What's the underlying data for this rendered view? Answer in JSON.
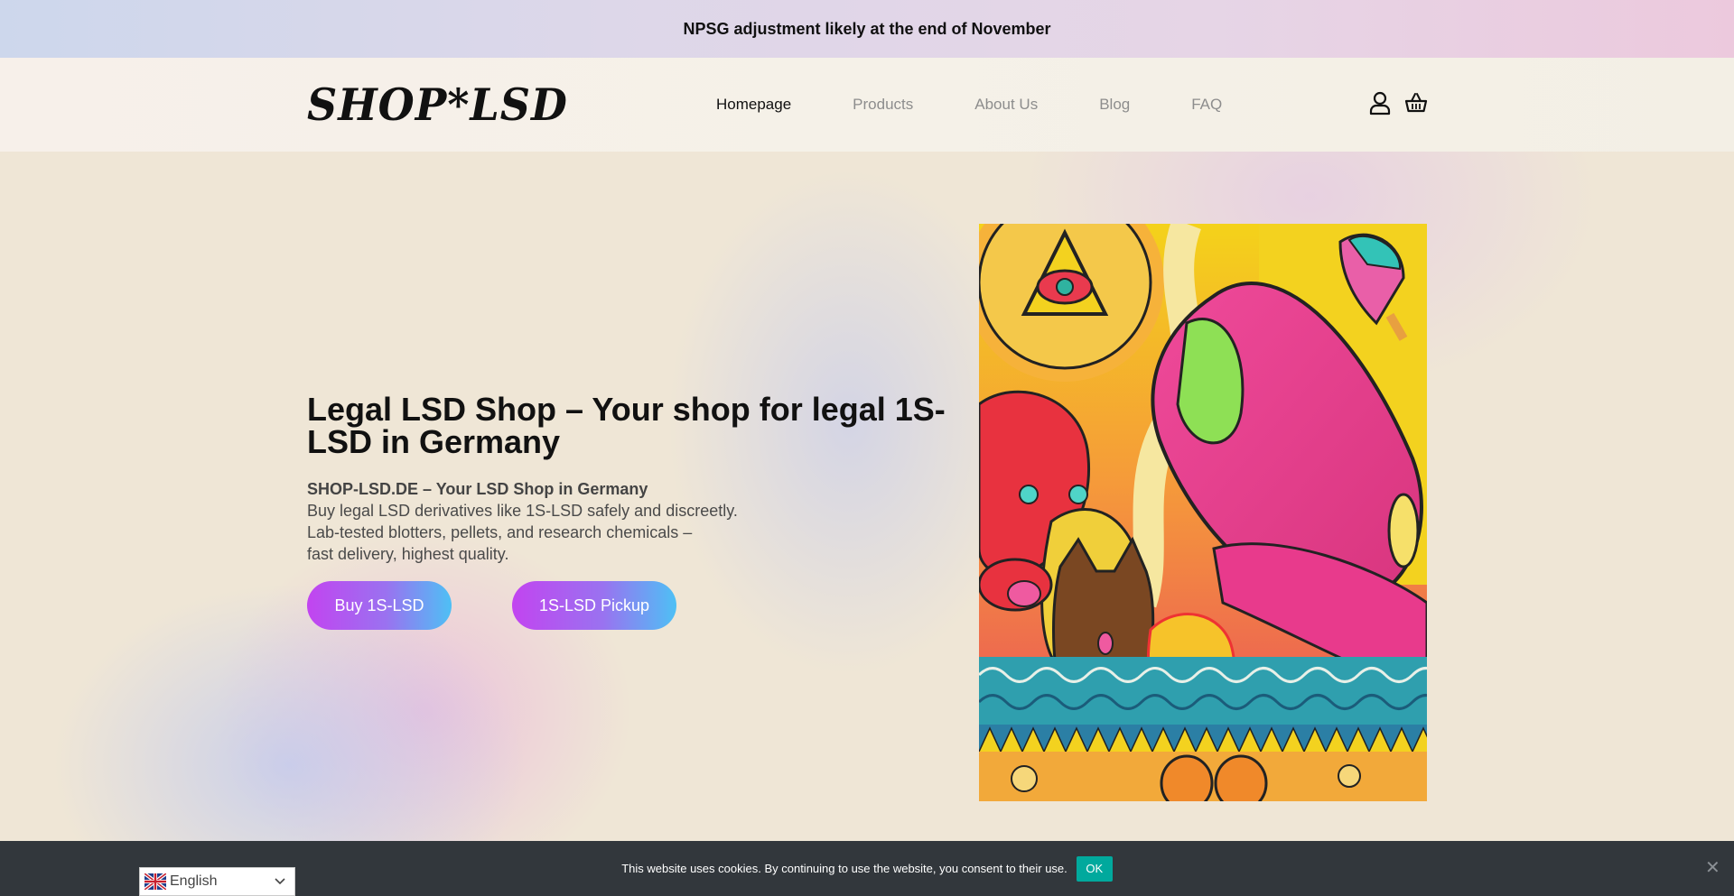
{
  "announcement": {
    "text": "NPSG adjustment likely at the end of November"
  },
  "header": {
    "logo_text": "SHOP*LSD",
    "nav": [
      {
        "label": "Homepage",
        "active": true
      },
      {
        "label": "Products",
        "active": false
      },
      {
        "label": "About Us",
        "active": false
      },
      {
        "label": "Blog",
        "active": false
      },
      {
        "label": "FAQ",
        "active": false
      }
    ],
    "icons": [
      "user-icon",
      "basket-icon"
    ]
  },
  "hero": {
    "title_bold": "Legal LSD Shop",
    "title_rest": " – Your shop for legal 1S-LSD in Germany",
    "lead_bold": "SHOP-LSD.DE – Your LSD Shop in Germany",
    "lead_lines": [
      "Buy legal LSD derivatives like 1S-LSD safely and discreetly.",
      "Lab-tested blotters, pellets, and research chemicals –",
      "fast delivery, highest quality."
    ],
    "buttons": {
      "primary": "Buy 1S-LSD",
      "secondary": "1S-LSD Pickup"
    },
    "image": "psychedelic-blotter-artwork"
  },
  "cookie_bar": {
    "text": "This website uses cookies. By continuing to use the website, you consent to their use.",
    "ok_label": "OK",
    "close_icon": "close-icon"
  },
  "language_switcher": {
    "selected": "English",
    "flag_icon": "uk-flag-icon"
  },
  "colors": {
    "button_gradient_start": "#c244f0",
    "button_gradient_end": "#4ec0f5",
    "cookie_bar_bg": "#32373c",
    "cookie_ok_bg": "#00a99d"
  }
}
